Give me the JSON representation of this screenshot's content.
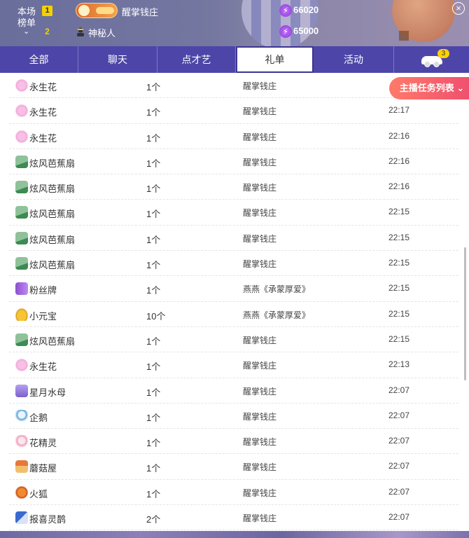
{
  "ranking": {
    "title": "本场榜单",
    "entries": [
      {
        "rank": "1",
        "name": "醒掌钱庄",
        "score": "66020"
      },
      {
        "rank": "2",
        "name": "神秘人",
        "score": "65000"
      }
    ]
  },
  "tabs": [
    {
      "label": "全部"
    },
    {
      "label": "聊天"
    },
    {
      "label": "点才艺"
    },
    {
      "label": "礼单",
      "active": true
    },
    {
      "label": "活动"
    },
    {
      "label": "",
      "icon": "car-icon",
      "badge": "3"
    }
  ],
  "task_button": {
    "label": "主播任务列表"
  },
  "gifts": [
    {
      "name": "永生花",
      "qty": "1个",
      "from": "醒掌钱庄",
      "time": "",
      "icon": "flower-icon"
    },
    {
      "name": "永生花",
      "qty": "1个",
      "from": "醒掌钱庄",
      "time": "22:17",
      "icon": "flower-icon"
    },
    {
      "name": "永生花",
      "qty": "1个",
      "from": "醒掌钱庄",
      "time": "22:16",
      "icon": "flower-icon"
    },
    {
      "name": "炫风芭蕉扇",
      "qty": "1个",
      "from": "醒掌钱庄",
      "time": "22:16",
      "icon": "banana-fan-icon"
    },
    {
      "name": "炫风芭蕉扇",
      "qty": "1个",
      "from": "醒掌钱庄",
      "time": "22:16",
      "icon": "banana-fan-icon"
    },
    {
      "name": "炫风芭蕉扇",
      "qty": "1个",
      "from": "醒掌钱庄",
      "time": "22:15",
      "icon": "banana-fan-icon"
    },
    {
      "name": "炫风芭蕉扇",
      "qty": "1个",
      "from": "醒掌钱庄",
      "time": "22:15",
      "icon": "banana-fan-icon"
    },
    {
      "name": "炫风芭蕉扇",
      "qty": "1个",
      "from": "醒掌钱庄",
      "time": "22:15",
      "icon": "banana-fan-icon"
    },
    {
      "name": "粉丝牌",
      "qty": "1个",
      "from": "燕燕《承蒙厚爱》",
      "time": "22:15",
      "icon": "fan-badge-icon"
    },
    {
      "name": "小元宝",
      "qty": "10个",
      "from": "燕燕《承蒙厚爱》",
      "time": "22:15",
      "icon": "gold-ingot-icon"
    },
    {
      "name": "炫风芭蕉扇",
      "qty": "1个",
      "from": "醒掌钱庄",
      "time": "22:15",
      "icon": "banana-fan-icon"
    },
    {
      "name": "永生花",
      "qty": "1个",
      "from": "醒掌钱庄",
      "time": "22:13",
      "icon": "flower-icon"
    },
    {
      "name": "星月水母",
      "qty": "1个",
      "from": "醒掌钱庄",
      "time": "22:07",
      "icon": "jellyfish-icon"
    },
    {
      "name": "企鹅",
      "qty": "1个",
      "from": "醒掌钱庄",
      "time": "22:07",
      "icon": "penguin-icon"
    },
    {
      "name": "花精灵",
      "qty": "1个",
      "from": "醒掌钱庄",
      "time": "22:07",
      "icon": "flower-sprite-icon"
    },
    {
      "name": "蘑菇屋",
      "qty": "1个",
      "from": "醒掌钱庄",
      "time": "22:07",
      "icon": "mushroom-house-icon"
    },
    {
      "name": "火狐",
      "qty": "1个",
      "from": "醒掌钱庄",
      "time": "22:07",
      "icon": "fire-fox-icon"
    },
    {
      "name": "报喜灵鹊",
      "qty": "2个",
      "from": "醒掌钱庄",
      "time": "22:07",
      "icon": "magpie-icon"
    }
  ]
}
